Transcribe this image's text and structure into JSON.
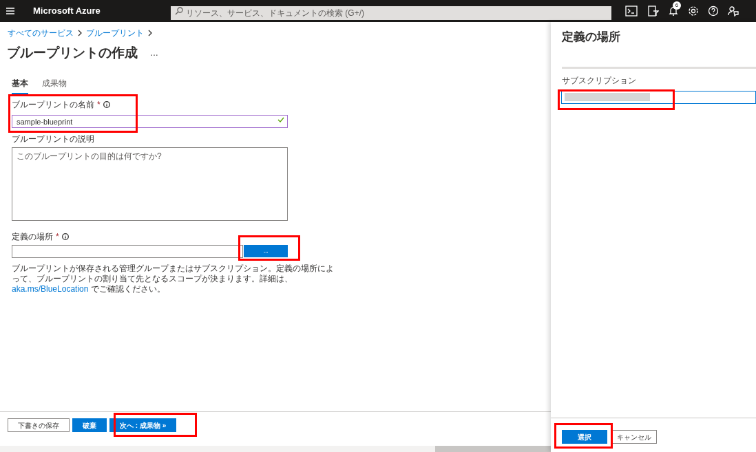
{
  "topbar": {
    "title": "Microsoft Azure",
    "search_placeholder": "リソース、サービス、ドキュメントの検索 (G+/)",
    "notification_count": "6"
  },
  "breadcrumb": [
    "すべてのサービス",
    "ブループリント"
  ],
  "page": {
    "title": "ブループリントの作成",
    "more": "…"
  },
  "tabs": [
    {
      "label": "基本",
      "selected": true
    },
    {
      "label": "成果物",
      "selected": false
    }
  ],
  "form": {
    "name_label": "ブループリントの名前",
    "name_required_mark": "*",
    "name_value": "sample-blueprint",
    "name_valid": true,
    "description_label": "ブループリントの説明",
    "description_placeholder": "このブループリントの目的は何ですか?",
    "location_label": "定義の場所",
    "location_required_mark": "*",
    "browse_button": "...",
    "help_text": "ブループリントが保存される管理グループまたはサブスクリプション。定義の場所によって、ブループリントの割り当て先となるスコープが決まります。詳細は、",
    "help_link": "aka.ms/BlueLocation",
    "help_suffix": " でご確認ください。"
  },
  "footer_buttons": [
    {
      "label": "下書きの保存",
      "kind": "secondary"
    },
    {
      "label": "破棄",
      "kind": "primary"
    },
    {
      "label": "次へ : 成果物 »",
      "kind": "primary"
    }
  ],
  "panel": {
    "title": "定義の場所",
    "subscription_label": "サブスクリプション",
    "buttons": [
      {
        "label": "選択",
        "kind": "primary"
      },
      {
        "label": "キャンセル",
        "kind": "secondary"
      }
    ]
  }
}
